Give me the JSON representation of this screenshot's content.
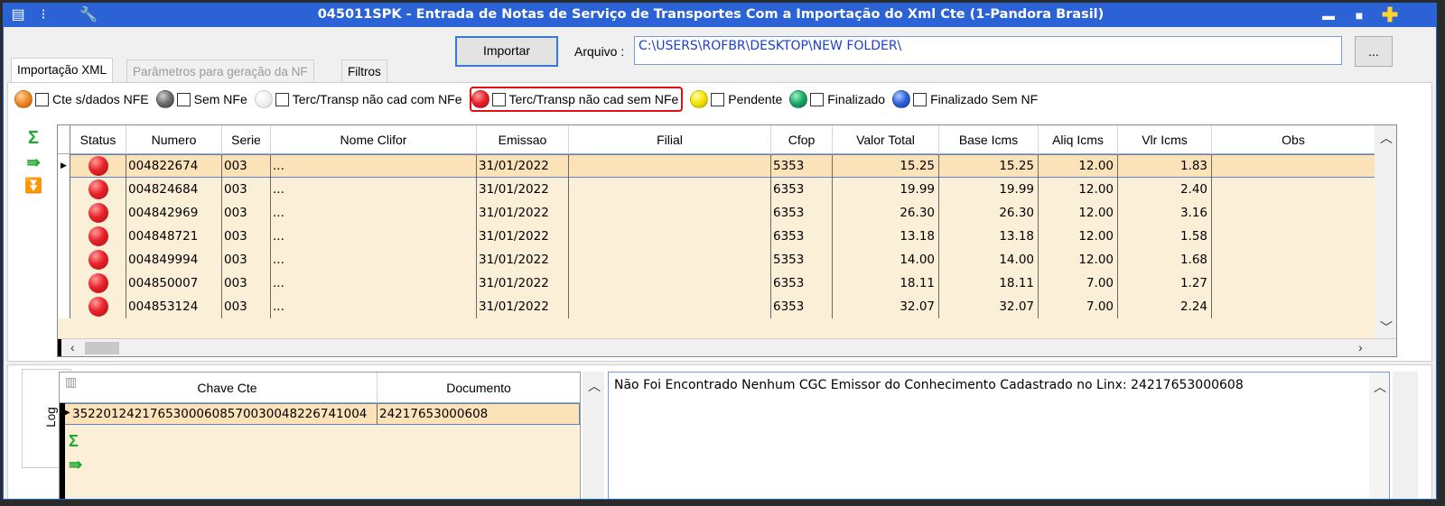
{
  "window": {
    "title": "045011SPK - Entrada de Notas de Serviço de Transportes Com a Importação do Xml Cte (1-Pandora Brasil)",
    "min_glyph": "▬",
    "max_glyph": "■",
    "close_glyph": "✚"
  },
  "toolbar": {
    "import_label": "Importar",
    "file_label": "Arquivo :",
    "file_path": "C:\\USERS\\ROFBR\\DESKTOP\\NEW FOLDER\\",
    "browse_label": "..."
  },
  "tabs": [
    {
      "label": "Importação XML"
    },
    {
      "label": "Parâmetros para geração da NF"
    },
    {
      "label": "Filtros"
    }
  ],
  "legend": [
    {
      "label": "Cte s/dados NFE",
      "color": "#f08a24"
    },
    {
      "label": "Sem NFe",
      "color": "#6f6f6f"
    },
    {
      "label": "Terc/Transp não cad com NFe",
      "color": "#f2f2f2"
    },
    {
      "label": "Terc/Transp não cad sem NFe",
      "color": "#e8232a"
    },
    {
      "label": "Pendente",
      "color": "#f5e400"
    },
    {
      "label": "Finalizado",
      "color": "#1aa866"
    },
    {
      "label": "Finalizado Sem NF",
      "color": "#2d63d8"
    }
  ],
  "grid": {
    "columns": [
      "Status",
      "Numero",
      "Serie",
      "Nome Clifor",
      "Emissao",
      "Filial",
      "Cfop",
      "Valor Total",
      "Base Icms",
      "Aliq Icms",
      "Vlr Icms",
      "Obs"
    ],
    "rows": [
      [
        "004822674",
        "003",
        "...",
        "31/01/2022",
        "",
        "5353",
        "15.25",
        "15.25",
        "12.00",
        "1.83",
        ""
      ],
      [
        "004824684",
        "003",
        "...",
        "31/01/2022",
        "",
        "6353",
        "19.99",
        "19.99",
        "12.00",
        "2.40",
        ""
      ],
      [
        "004842969",
        "003",
        "...",
        "31/01/2022",
        "",
        "6353",
        "26.30",
        "26.30",
        "12.00",
        "3.16",
        ""
      ],
      [
        "004848721",
        "003",
        "...",
        "31/01/2022",
        "",
        "6353",
        "13.18",
        "13.18",
        "12.00",
        "1.58",
        ""
      ],
      [
        "004849994",
        "003",
        "...",
        "31/01/2022",
        "",
        "5353",
        "14.00",
        "14.00",
        "12.00",
        "1.68",
        ""
      ],
      [
        "004850007",
        "003",
        "...",
        "31/01/2022",
        "",
        "6353",
        "18.11",
        "18.11",
        "7.00",
        "1.27",
        ""
      ],
      [
        "004853124",
        "003",
        "...",
        "31/01/2022",
        "",
        "6353",
        "32.07",
        "32.07",
        "7.00",
        "2.24",
        ""
      ]
    ]
  },
  "log": {
    "tab_label": "Log",
    "columns": [
      "Chave Cte",
      "Documento"
    ],
    "rows": [
      [
        "35220124217653000608570030048226741004",
        "24217653000608"
      ]
    ],
    "message": "Não Foi Encontrado Nenhum CGC Emissor do Conhecimento Cadastrado no Linx: 24217653000608"
  }
}
